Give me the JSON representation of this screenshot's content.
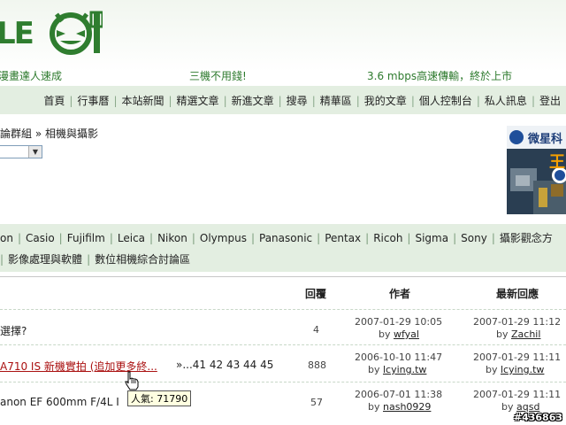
{
  "header": {
    "logo_text": "LE",
    "promos": [
      "漫畫達人速成",
      "三機不用錢!",
      "3.6 mbps高速傳輸，終於上市"
    ]
  },
  "nav": {
    "items": [
      "首頁",
      "行事曆",
      "本站新聞",
      "精選文章",
      "新進文章",
      "搜尋",
      "精華區",
      "我的文章",
      "個人控制台",
      "私人訊息",
      "登出"
    ],
    "separator": "|"
  },
  "breadcrumb": {
    "parent": "論群組",
    "arrow": "»",
    "current": "相機與攝影"
  },
  "ad": {
    "text_top": "微星科",
    "text_mid": "王"
  },
  "brands": {
    "row1": [
      "on",
      "Casio",
      "Fujifilm",
      "Leica",
      "Nikon",
      "Olympus",
      "Panasonic",
      "Pentax",
      "Ricoh",
      "Sigma",
      "Sony",
      "攝影觀念方"
    ],
    "row2": [
      "影像處理與軟體",
      "數位相機綜合討論區"
    ]
  },
  "table": {
    "headers": {
      "replies": "回覆",
      "author": "作者",
      "latest": "最新回應"
    },
    "rows": [
      {
        "title": "選擇?",
        "pages": "",
        "replies": "4",
        "author_date": "2007-01-29 10:05",
        "author_by": "by",
        "author": "wfyal",
        "last_date": "2007-01-29 11:12",
        "last_by": "by",
        "last_user": "Zachil"
      },
      {
        "title": "A710 IS 新機實拍 (追加更多終...",
        "pages": "»...41 42 43 44 45",
        "replies": "888",
        "author_date": "2006-10-10 11:47",
        "author_by": "by",
        "author": "lcying.tw",
        "last_date": "2007-01-29 11:11",
        "last_by": "by",
        "last_user": "lcying.tw"
      },
      {
        "title": "anon EF 600mm F/4L I",
        "pages": "",
        "replies": "57",
        "author_date": "2006-07-01 11:38",
        "author_by": "by",
        "author": "nash0929",
        "last_date": "2007-01-29 11:11",
        "last_by": "by",
        "last_user": "aqsd"
      }
    ]
  },
  "tooltip": {
    "text": "人氣: 71790"
  },
  "watermark": {
    "id": "#436863"
  },
  "colors": {
    "accent_green": "#2f7d2f",
    "nav_bg": "#e3eee1",
    "link_red": "#aa1111"
  }
}
